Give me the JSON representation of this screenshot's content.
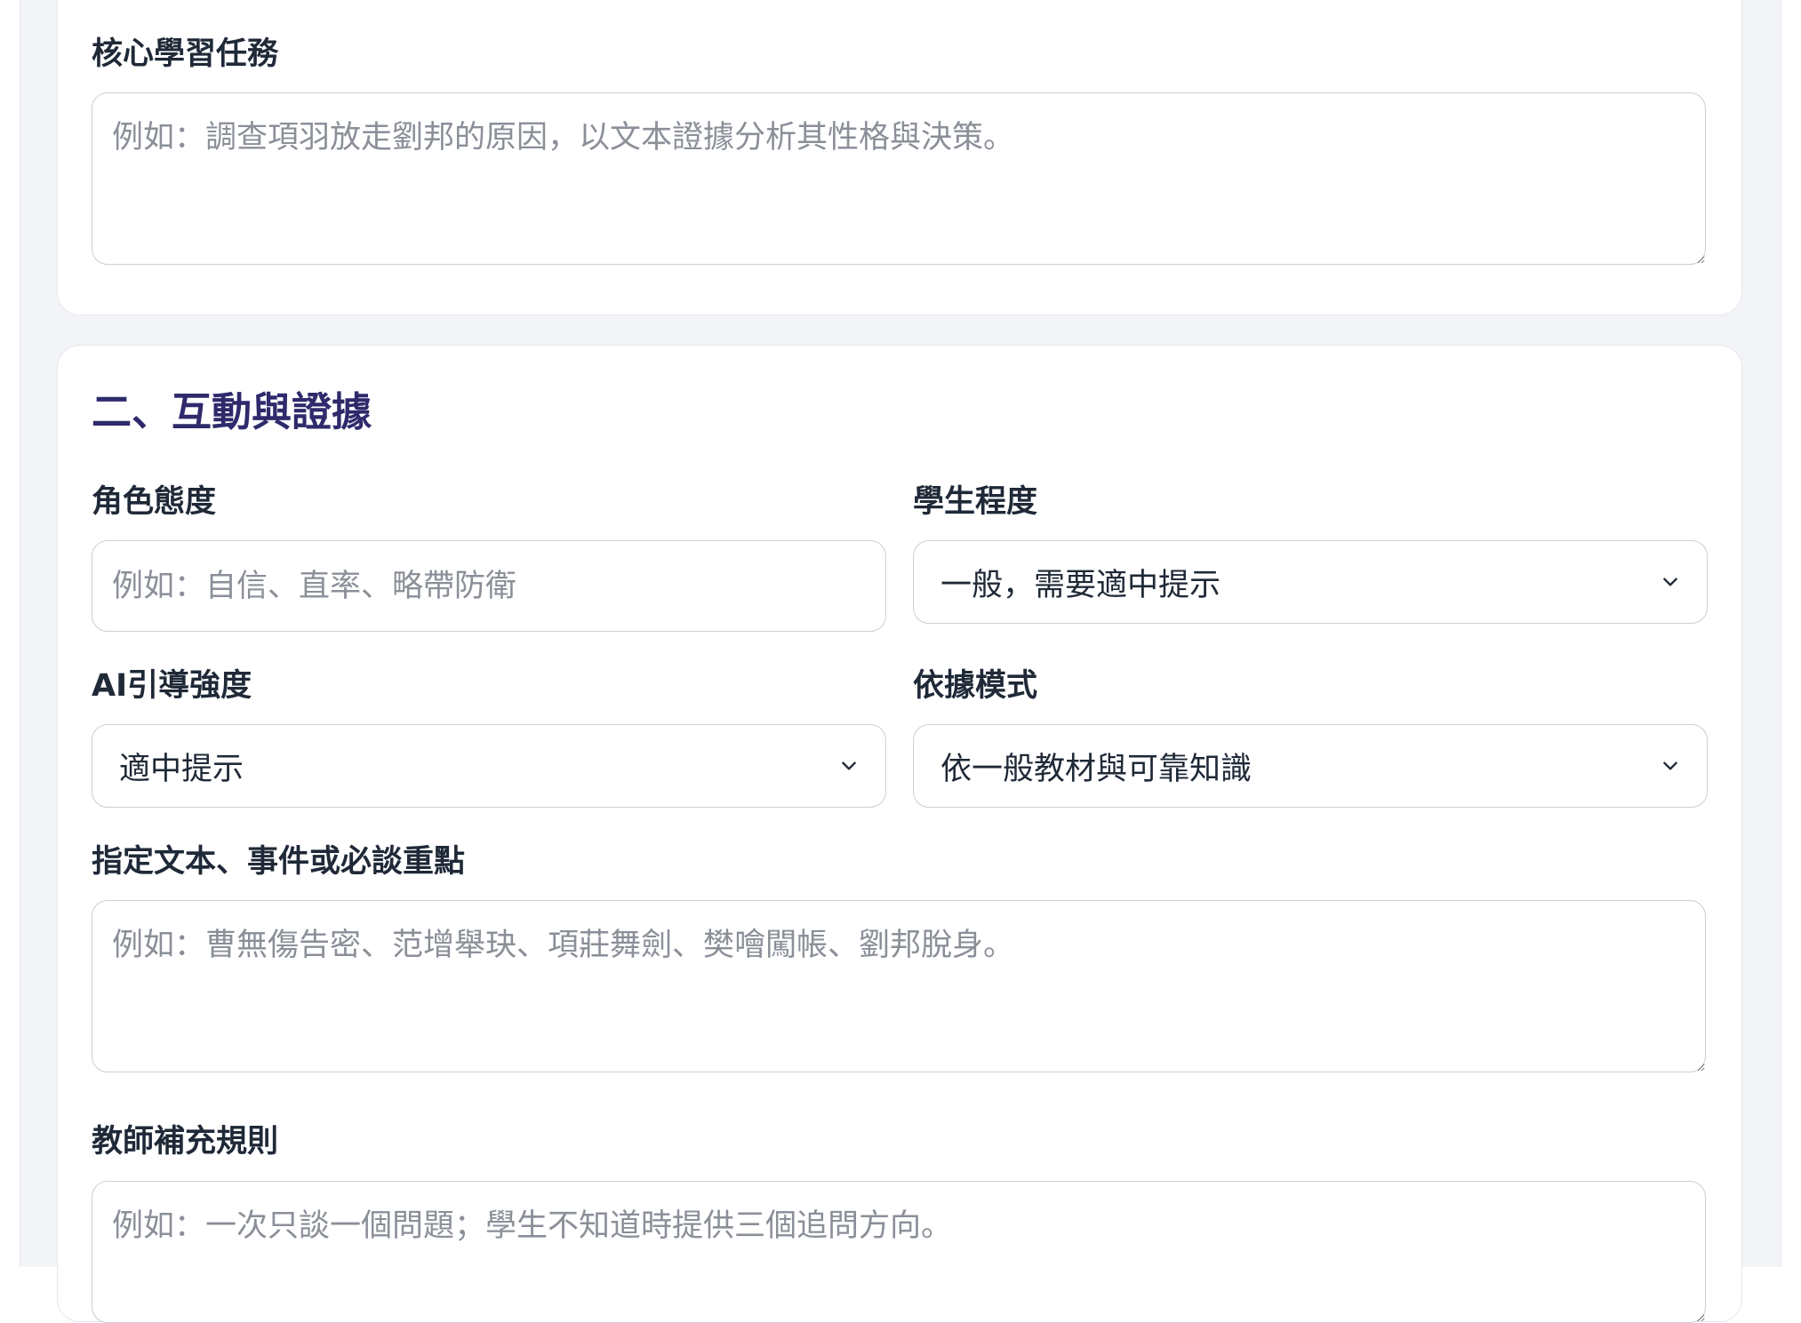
{
  "section1": {
    "core_task_label": "核心學習任務",
    "core_task_placeholder": "例如：調查項羽放走劉邦的原因，以文本證據分析其性格與決策。"
  },
  "section2": {
    "title": "二、互動與證據",
    "role_attitude": {
      "label": "角色態度",
      "placeholder": "例如：自信、直率、略帶防衛"
    },
    "student_level": {
      "label": "學生程度",
      "value": "一般，需要適中提示"
    },
    "ai_guidance": {
      "label": "AI引導強度",
      "value": "適中提示"
    },
    "evidence_mode": {
      "label": "依據模式",
      "value": "依一般教材與可靠知識"
    },
    "key_points": {
      "label": "指定文本、事件或必談重點",
      "placeholder": "例如：曹無傷告密、范增舉玦、項莊舞劍、樊噲闖帳、劉邦脫身。"
    },
    "teacher_rules": {
      "label": "教師補充規則",
      "placeholder": "例如：一次只談一個問題；學生不知道時提供三個追問方向。"
    }
  },
  "colors": {
    "section_title": "#2e2a6b",
    "page_background": "#f3f4f7",
    "card_background": "#ffffff",
    "field_border": "#c9ced8",
    "placeholder": "#8a8f98"
  },
  "icons": {
    "select_arrow": "chevron-down-icon",
    "textarea_resize": "resize-grip-icon"
  }
}
